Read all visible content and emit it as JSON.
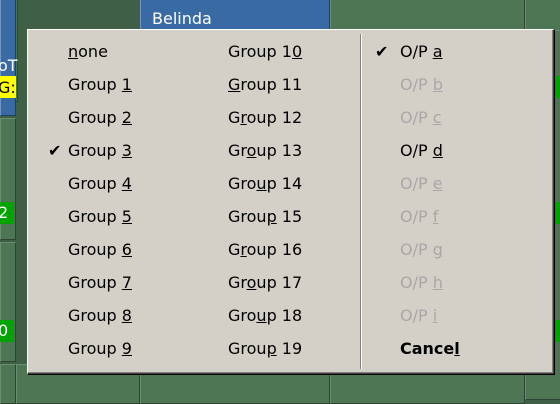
{
  "background": {
    "name_label": "Belinda",
    "left_texts": [
      "oT",
      "G:",
      "2",
      "0"
    ]
  },
  "menu": {
    "groups_col1": [
      {
        "pre": "",
        "key": "n",
        "post": "one",
        "checked": false
      },
      {
        "pre": "Group ",
        "key": "1",
        "post": "",
        "checked": false
      },
      {
        "pre": "Group ",
        "key": "2",
        "post": "",
        "checked": false
      },
      {
        "pre": "Group ",
        "key": "3",
        "post": "",
        "checked": true
      },
      {
        "pre": "Group ",
        "key": "4",
        "post": "",
        "checked": false
      },
      {
        "pre": "Group ",
        "key": "5",
        "post": "",
        "checked": false
      },
      {
        "pre": "Group ",
        "key": "6",
        "post": "",
        "checked": false
      },
      {
        "pre": "Group ",
        "key": "7",
        "post": "",
        "checked": false
      },
      {
        "pre": "Group ",
        "key": "8",
        "post": "",
        "checked": false
      },
      {
        "pre": "Group ",
        "key": "9",
        "post": "",
        "checked": false
      }
    ],
    "groups_col2": [
      {
        "pre": "Group 1",
        "key": "0",
        "post": ""
      },
      {
        "pre": "",
        "key": "G",
        "post": "roup 11"
      },
      {
        "pre": "G",
        "key": "r",
        "post": "oup 12"
      },
      {
        "pre": "Gr",
        "key": "o",
        "post": "up 13"
      },
      {
        "pre": "Gro",
        "key": "u",
        "post": "p 14"
      },
      {
        "pre": "Grou",
        "key": "p",
        "post": " 15"
      },
      {
        "pre": "G",
        "key": "r",
        "post": "oup 16"
      },
      {
        "pre": "Gr",
        "key": "o",
        "post": "up 17"
      },
      {
        "pre": "Gro",
        "key": "u",
        "post": "p 18"
      },
      {
        "pre": "Grou",
        "key": "p",
        "post": " 19"
      }
    ],
    "outputs": [
      {
        "pre": "O/P ",
        "key": "a",
        "post": "",
        "checked": true,
        "enabled": true,
        "bold": false
      },
      {
        "pre": "O/P ",
        "key": "b",
        "post": "",
        "checked": false,
        "enabled": false,
        "bold": false
      },
      {
        "pre": "O/P ",
        "key": "c",
        "post": "",
        "checked": false,
        "enabled": false,
        "bold": false
      },
      {
        "pre": "O/P ",
        "key": "d",
        "post": "",
        "checked": false,
        "enabled": true,
        "bold": false
      },
      {
        "pre": "O/P ",
        "key": "e",
        "post": "",
        "checked": false,
        "enabled": false,
        "bold": false
      },
      {
        "pre": "O/P ",
        "key": "f",
        "post": "",
        "checked": false,
        "enabled": false,
        "bold": false
      },
      {
        "pre": "O/P ",
        "key": "g",
        "post": "",
        "checked": false,
        "enabled": false,
        "bold": false
      },
      {
        "pre": "O/P ",
        "key": "h",
        "post": "",
        "checked": false,
        "enabled": false,
        "bold": false
      },
      {
        "pre": "O/P ",
        "key": "i",
        "post": "",
        "checked": false,
        "enabled": false,
        "bold": false
      },
      {
        "pre": "Cance",
        "key": "l",
        "post": "",
        "checked": false,
        "enabled": true,
        "bold": true
      }
    ],
    "check_glyph": "✔"
  }
}
